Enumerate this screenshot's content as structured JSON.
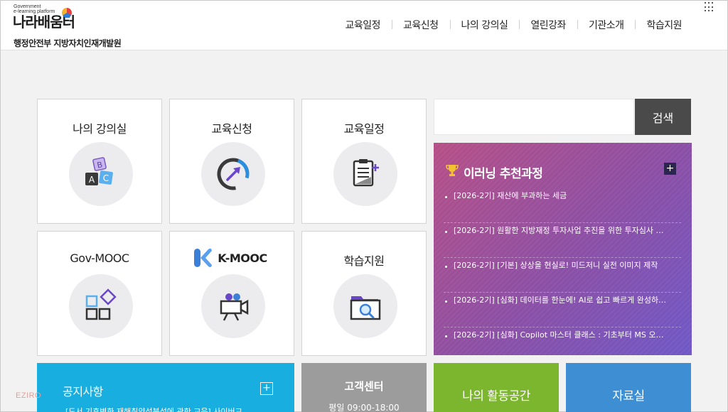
{
  "header": {
    "logo_small": "Government\ne-learning platform",
    "logo_main": "나라배움터",
    "org_name": "행정안전부 지방자치인재개발원",
    "nav": [
      "교육일정",
      "교육신청",
      "나의 강의실",
      "열린강좌",
      "기관소개",
      "학습지원"
    ]
  },
  "tiles": [
    {
      "label": "나의 강의실",
      "icon": "abc-blocks-icon"
    },
    {
      "label": "교육신청",
      "icon": "progress-arrow-icon"
    },
    {
      "label": "교육일정",
      "icon": "clipboard-add-icon"
    },
    {
      "label": "Gov-MOOC",
      "icon": "shapes-icon"
    },
    {
      "label": "K-MOOC",
      "icon": "video-camera-icon"
    },
    {
      "label": "학습지원",
      "icon": "folder-search-icon"
    }
  ],
  "search": {
    "button_label": "검색",
    "placeholder": ""
  },
  "recommend": {
    "title": "이러닝 추천과정",
    "items": [
      "[2026-2기] 재산에 부과하는 세금",
      "[2026-2기] 원활한 지방재정 투자사업 추진을 위한 투자심사 …",
      "[2026-2기] [기본] 상상을 현실로! 미드저니 실전 이미지 제작",
      "[2026-2기] [심화] 데이터를 한눈에! AI로 쉽고 빠르게 완성하…",
      "[2026-2기] [심화] Copilot 마스터 클래스 : 기초부터 MS 오…"
    ]
  },
  "notice": {
    "title": "공지사항",
    "item": "[도서 기후변화 재해취약성분석에 관한 교육] 사이버교…"
  },
  "service": {
    "title": "고객센터",
    "hours": "평일 09:00-18:00"
  },
  "myspace": {
    "label": "나의 활동공간"
  },
  "archive": {
    "label": "자료실"
  },
  "watermark": "EZIRO",
  "colors": {
    "notice": "#18aee0",
    "service": "#9c9c9c",
    "myspace": "#7cb52e",
    "archive": "#3d8ed3",
    "search_button": "#4a4a4a",
    "recommend_from": "#b64f86",
    "recommend_to": "#6f58c6"
  }
}
